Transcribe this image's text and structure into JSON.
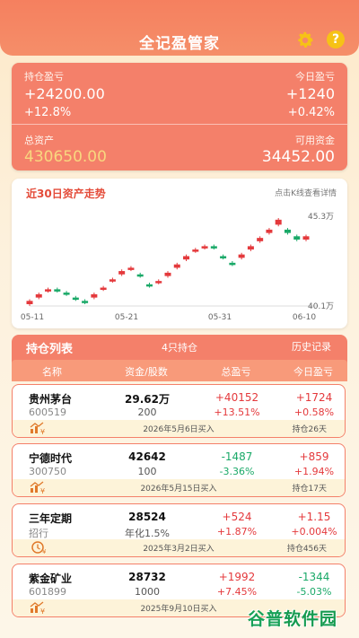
{
  "app": {
    "title": "全记盈管家"
  },
  "summary": {
    "hold_profit_label": "持仓盈亏",
    "hold_profit": "+24200.00",
    "hold_profit_pct": "+12.8%",
    "today_profit_label": "今日盈亏",
    "today_profit": "+1240",
    "today_profit_pct": "+0.42%",
    "total_assets_label": "总资产",
    "total_assets": "430650.00",
    "available_label": "可用资金",
    "available": "34452.00"
  },
  "chart": {
    "title": "近30日资产走势",
    "hint": "点击K线查看详情"
  },
  "chart_data": {
    "type": "candlestick",
    "x_ticks": [
      "05-11",
      "05-21",
      "05-31",
      "06-10"
    ],
    "y_ticks": [
      "45.3万",
      "40.1万"
    ],
    "ylim": [
      40.1,
      45.3
    ],
    "candles": [
      {
        "open": 40.1,
        "close": 40.3,
        "high": 40.4,
        "low": 40.0
      },
      {
        "open": 40.5,
        "close": 40.7,
        "high": 40.8,
        "low": 40.4
      },
      {
        "open": 40.9,
        "close": 41.0,
        "high": 41.1,
        "low": 40.8
      },
      {
        "open": 41.0,
        "close": 40.9,
        "high": 41.1,
        "low": 40.8
      },
      {
        "open": 40.8,
        "close": 40.7,
        "high": 40.9,
        "low": 40.6
      },
      {
        "open": 40.5,
        "close": 40.4,
        "high": 40.6,
        "low": 40.3
      },
      {
        "open": 40.3,
        "close": 40.2,
        "high": 40.4,
        "low": 40.1
      },
      {
        "open": 40.5,
        "close": 40.7,
        "high": 40.8,
        "low": 40.4
      },
      {
        "open": 41.0,
        "close": 41.1,
        "high": 41.2,
        "low": 40.9
      },
      {
        "open": 41.5,
        "close": 41.6,
        "high": 41.7,
        "low": 41.4
      },
      {
        "open": 41.9,
        "close": 42.1,
        "high": 42.2,
        "low": 41.8
      },
      {
        "open": 42.2,
        "close": 42.3,
        "high": 42.4,
        "low": 42.1
      },
      {
        "open": 41.9,
        "close": 41.8,
        "high": 42.0,
        "low": 41.7
      },
      {
        "open": 41.3,
        "close": 41.2,
        "high": 41.4,
        "low": 41.1
      },
      {
        "open": 41.4,
        "close": 41.5,
        "high": 41.6,
        "low": 41.3
      },
      {
        "open": 41.8,
        "close": 42.0,
        "high": 42.1,
        "low": 41.7
      },
      {
        "open": 42.3,
        "close": 42.5,
        "high": 42.6,
        "low": 42.2
      },
      {
        "open": 42.8,
        "close": 43.0,
        "high": 43.1,
        "low": 42.7
      },
      {
        "open": 43.3,
        "close": 43.4,
        "high": 43.5,
        "low": 43.2
      },
      {
        "open": 43.5,
        "close": 43.6,
        "high": 43.7,
        "low": 43.4
      },
      {
        "open": 43.6,
        "close": 43.5,
        "high": 43.7,
        "low": 43.4
      },
      {
        "open": 43.0,
        "close": 42.9,
        "high": 43.1,
        "low": 42.8
      },
      {
        "open": 42.6,
        "close": 42.5,
        "high": 42.7,
        "low": 42.4
      },
      {
        "open": 42.9,
        "close": 43.1,
        "high": 43.2,
        "low": 42.8
      },
      {
        "open": 43.4,
        "close": 43.6,
        "high": 43.7,
        "low": 43.3
      },
      {
        "open": 43.9,
        "close": 44.1,
        "high": 44.2,
        "low": 43.8
      },
      {
        "open": 44.4,
        "close": 44.6,
        "high": 44.7,
        "low": 44.3
      },
      {
        "open": 44.9,
        "close": 45.2,
        "high": 45.3,
        "low": 44.8
      },
      {
        "open": 44.6,
        "close": 44.4,
        "high": 44.7,
        "low": 44.3
      },
      {
        "open": 44.2,
        "close": 44.0,
        "high": 44.3,
        "low": 43.9
      },
      {
        "open": 44.0,
        "close": 44.2,
        "high": 44.3,
        "low": 43.9
      }
    ],
    "colors": {
      "up": "#e4393c",
      "down": "#1aa968"
    }
  },
  "list": {
    "title": "持仓列表",
    "count": "4只持仓",
    "history": "历史记录",
    "columns": [
      "名称",
      "资金/股数",
      "总盈亏",
      "今日盈亏"
    ],
    "rows": [
      {
        "name": "贵州茅台",
        "code": "600519",
        "amount": "29.62万",
        "qty": "200",
        "total": "+40152",
        "total_pct": "+13.51%",
        "total_dir": "up",
        "today": "+1724",
        "today_pct": "+0.58%",
        "today_dir": "up",
        "buy_date": "2026年5月6日买入",
        "hold": "持仓26天",
        "icon": "stock-icon"
      },
      {
        "name": "宁德时代",
        "code": "300750",
        "amount": "42642",
        "qty": "100",
        "total": "-1487",
        "total_pct": "-3.36%",
        "total_dir": "down",
        "today": "+859",
        "today_pct": "+1.94%",
        "today_dir": "up",
        "buy_date": "2026年5月15日买入",
        "hold": "持仓17天",
        "icon": "stock-icon"
      },
      {
        "name": "三年定期",
        "code": "招行",
        "amount": "28524",
        "qty": "年化1.5%",
        "total": "+524",
        "total_pct": "+1.87%",
        "total_dir": "up",
        "today": "+1.15",
        "today_pct": "+0.004%",
        "today_dir": "up",
        "buy_date": "2025年3月2日买入",
        "hold": "持仓456天",
        "icon": "deposit-icon"
      },
      {
        "name": "紫金矿业",
        "code": "601899",
        "amount": "28732",
        "qty": "1000",
        "total": "+1992",
        "total_pct": "+7.45%",
        "total_dir": "up",
        "today": "-1344",
        "today_pct": "-5.03%",
        "today_dir": "down",
        "buy_date": "2025年9月10日买入",
        "hold": "",
        "icon": "stock-icon"
      }
    ]
  },
  "watermark": {
    "text1": "谷普",
    "text2": "软件园"
  }
}
